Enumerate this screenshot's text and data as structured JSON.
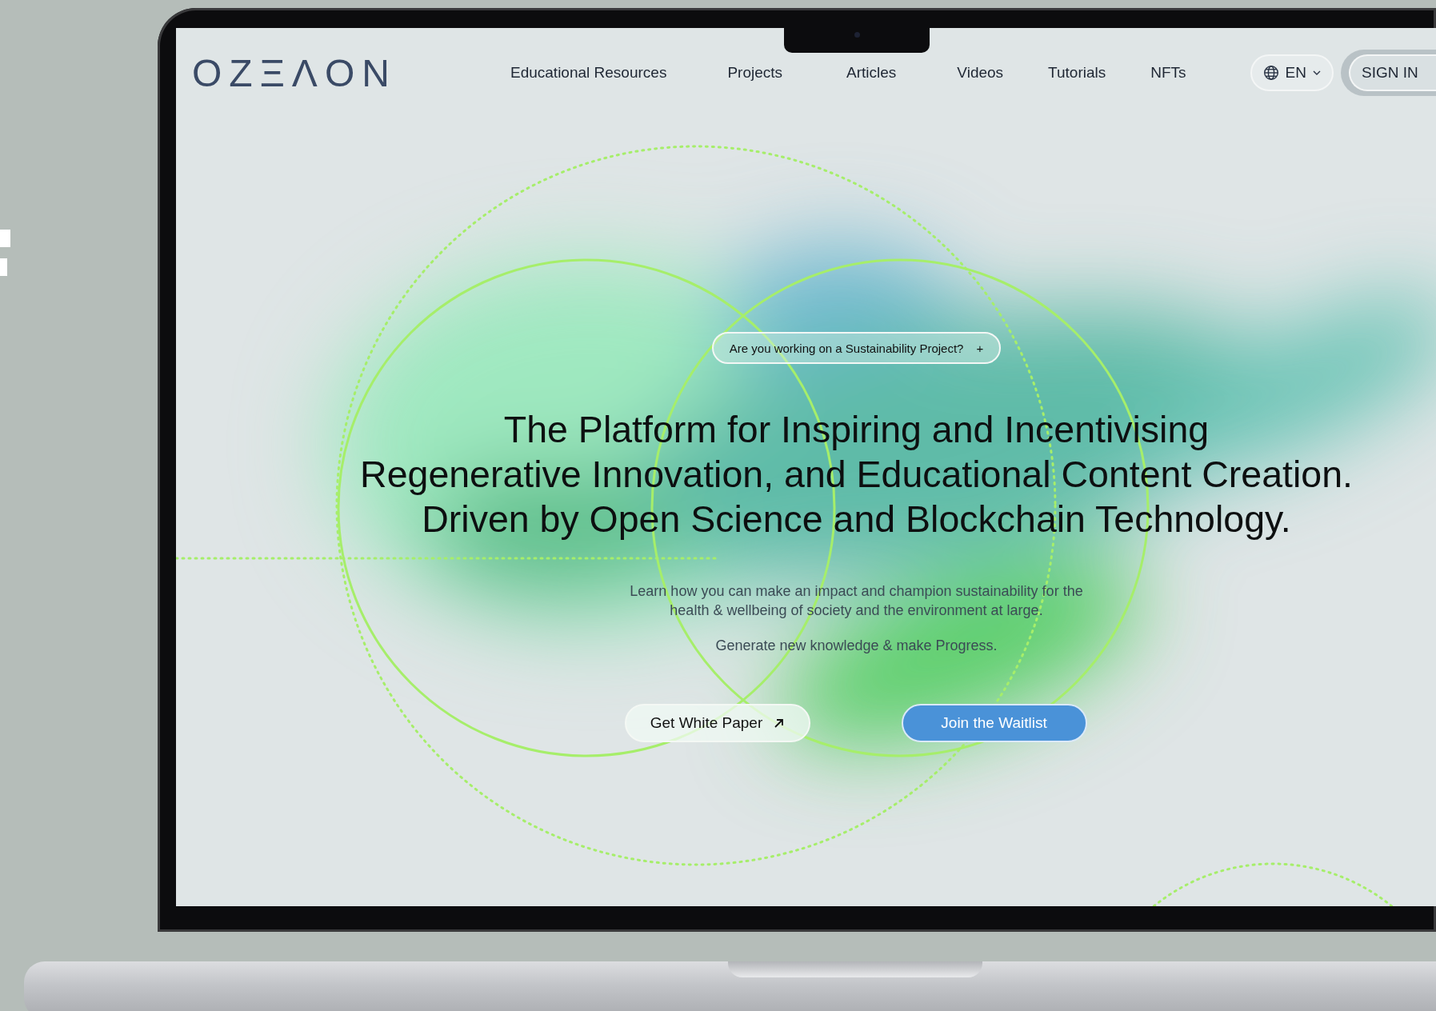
{
  "logo": {
    "text": "OZΞΛON"
  },
  "nav": {
    "items": [
      {
        "label": "Educational Resources"
      },
      {
        "label": "Projects"
      },
      {
        "label": "Articles"
      },
      {
        "label": "Videos"
      },
      {
        "label": "Tutorials"
      },
      {
        "label": "NFTs"
      }
    ]
  },
  "language": {
    "label": "EN"
  },
  "sign_in": {
    "label": "SIGN IN"
  },
  "hero": {
    "badge": {
      "label": "Are you working on a Sustainability Project?",
      "symbol": "+"
    },
    "heading_lines": [
      "The Platform for Inspiring and Incentivising",
      "Regenerative Innovation, and Educational Content Creation.",
      "Driven by Open Science and Blockchain Technology."
    ],
    "description_lines": [
      "Learn how you can make an impact and champion sustainability for the",
      "health & wellbeing of society and the environment at large."
    ],
    "tagline": "Generate new knowledge & make Progress.",
    "buttons": [
      {
        "label": "Get White Paper",
        "kind": "outline"
      },
      {
        "label": "Join the Waitlist",
        "kind": "primary"
      }
    ]
  }
}
